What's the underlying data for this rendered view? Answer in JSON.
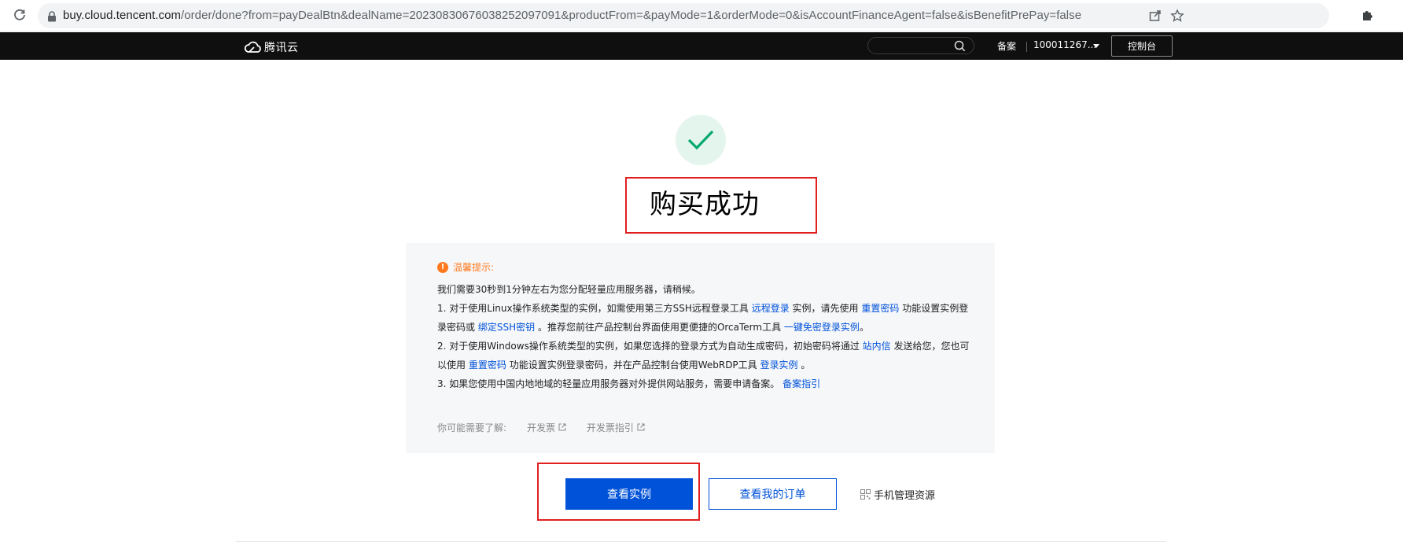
{
  "browser": {
    "url_host": "buy.cloud.tencent.com",
    "url_rest": "/order/done?from=payDealBtn&dealName=20230830676038252097091&productFrom=&payMode=1&orderMode=0&isAccountFinanceAgent=false&isBenefitPrePay=false"
  },
  "header": {
    "logo_text": "腾讯云",
    "beian_label": "备案",
    "account_label": "100011267...",
    "console_label": "控制台"
  },
  "main": {
    "title": "购买成功"
  },
  "notice": {
    "tip_title": "温馨提示:",
    "line0": "我们需要30秒到1分钟左右为您分配轻量应用服务器，请稍候。",
    "line1": {
      "a": "1. 对于使用Linux操作系统类型的实例，如需使用第三方SSH远程登录工具",
      "l1": "远程登录",
      "b": "实例，请先使用",
      "l2": "重置密码",
      "c": "功能设置实例登"
    },
    "line2": {
      "a": "录密码或",
      "l1": "绑定SSH密钥",
      "b": "。推荐您前往产品控制台界面使用更便捷的OrcaTerm工具",
      "l2": "一键免密登录实例",
      "c": "。"
    },
    "line3": {
      "a": "2. 对于使用Windows操作系统类型的实例，如果您选择的登录方式为自动生成密码，初始密码将通过",
      "l1": "站内信",
      "b": "发送给您，您也可"
    },
    "line4": {
      "a": "以使用",
      "l1": "重置密码",
      "b": "功能设置实例登录密码，并在产品控制台使用WebRDP工具",
      "l2": "登录实例",
      "c": "。"
    },
    "line5": {
      "a": "3. 如果您使用中国内地地域的轻量应用服务器对外提供网站服务，需要申请备案。",
      "l1": "备案指引"
    },
    "learn_label": "你可能需要了解:",
    "learn_links": [
      "开发票",
      "开发票指引"
    ]
  },
  "actions": {
    "primary": "查看实例",
    "secondary": "查看我的订单",
    "mobile": "手机管理资源"
  },
  "colors": {
    "accent": "#0052d9",
    "success": "#00a870",
    "warning": "#ff7a1f",
    "highlight": "#e02020"
  }
}
